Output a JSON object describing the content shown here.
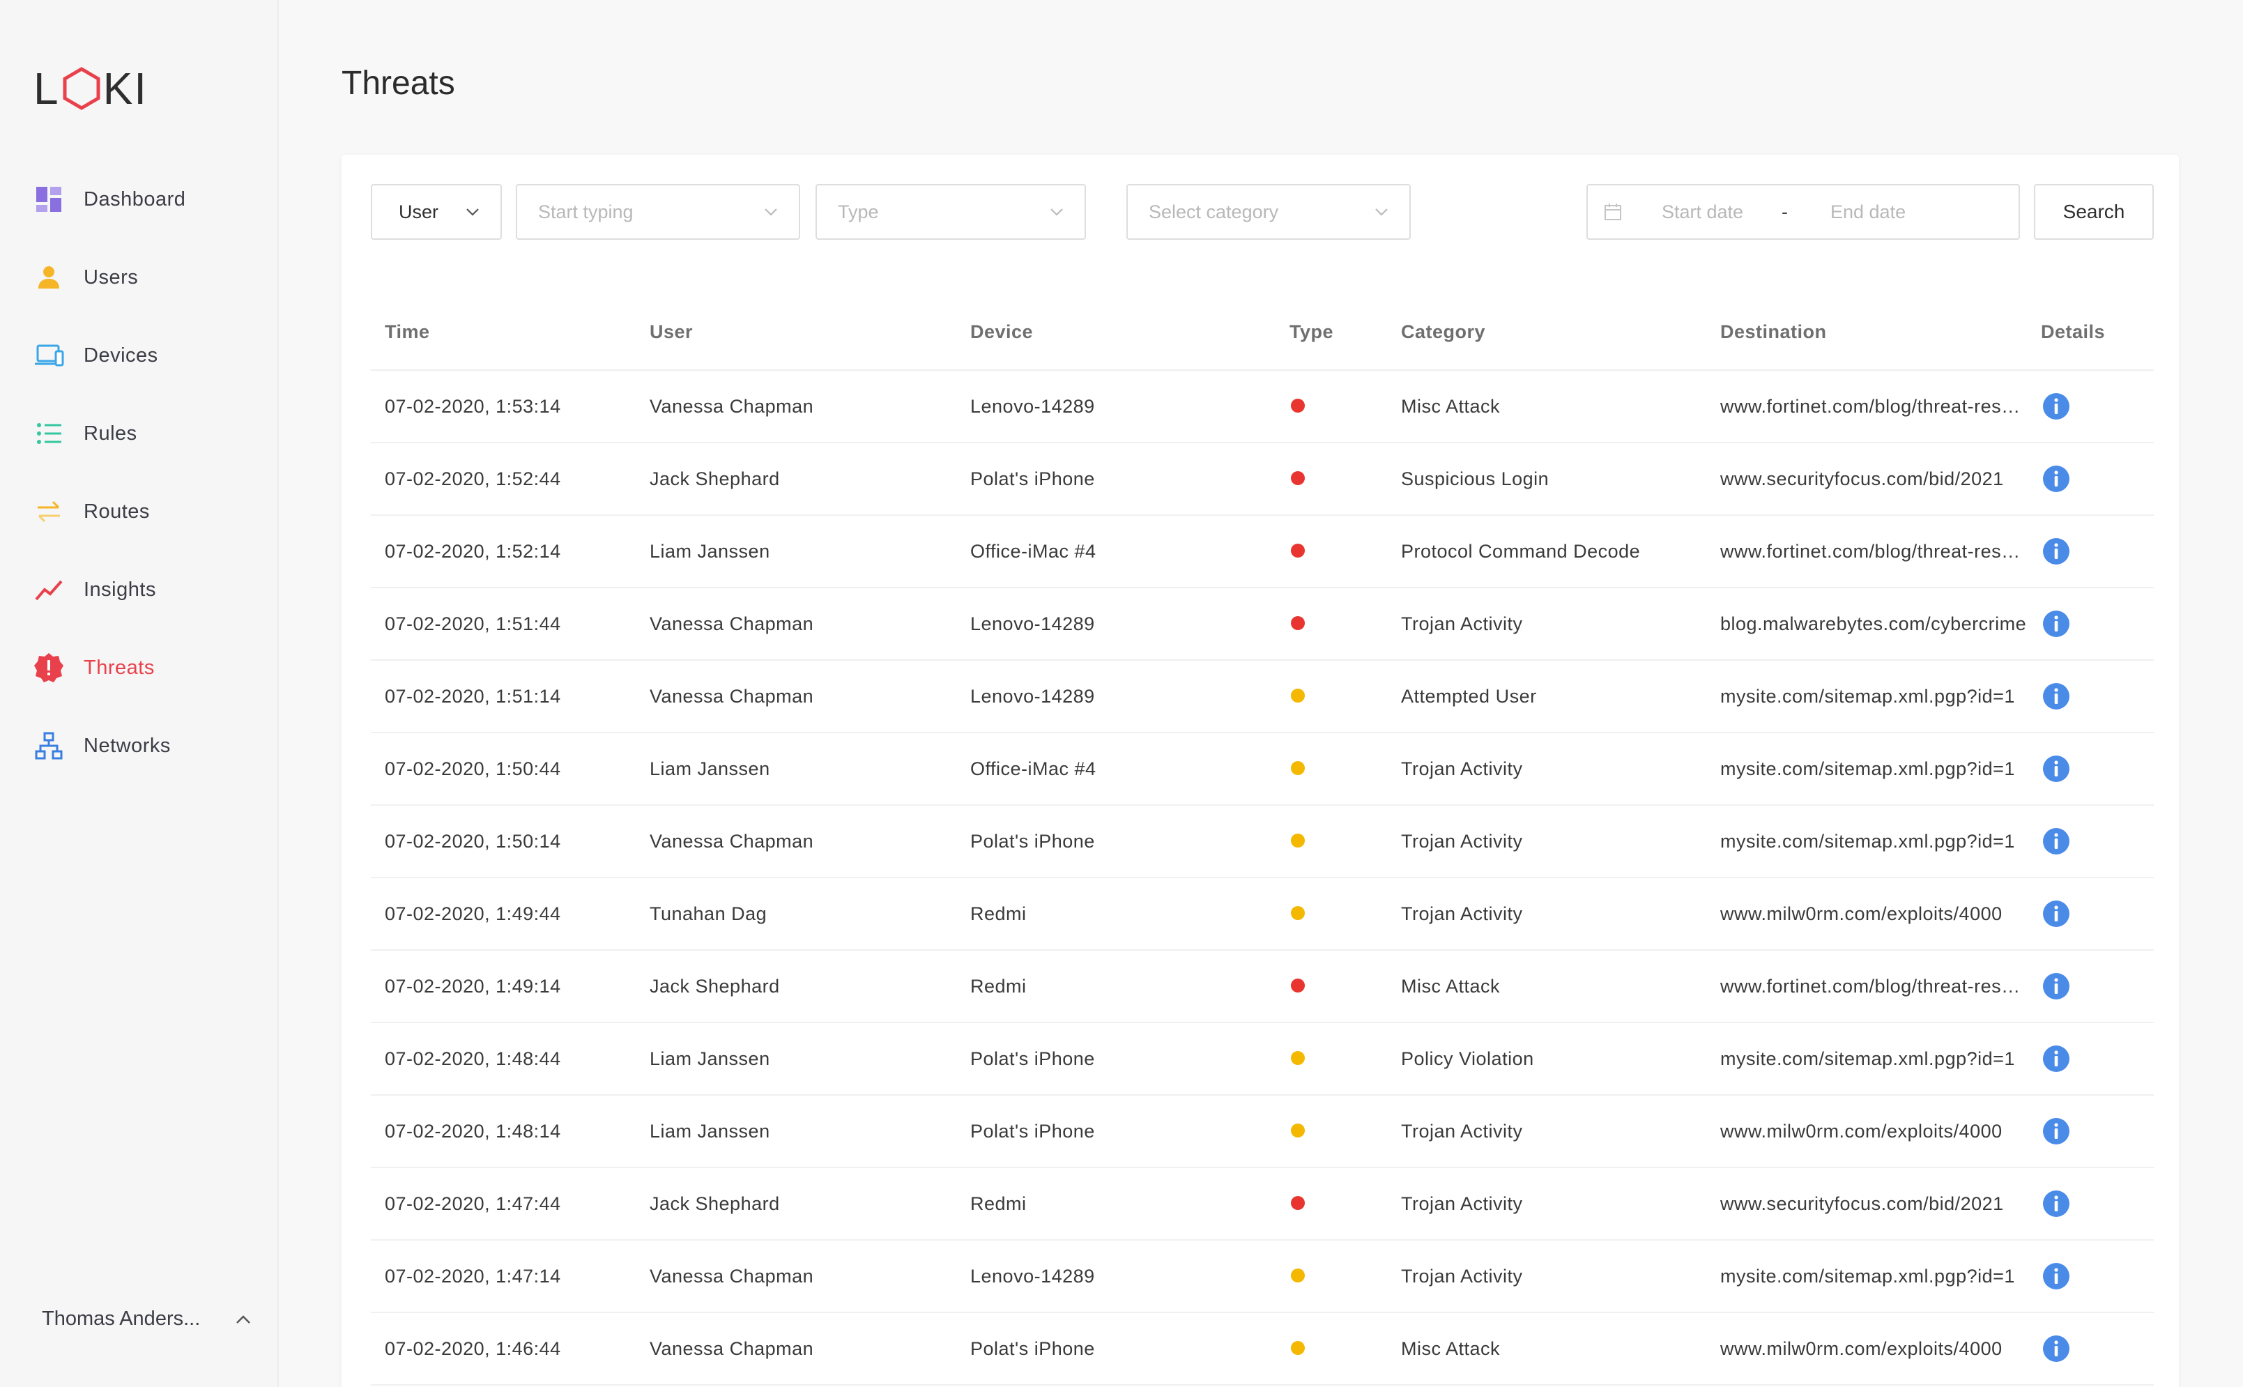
{
  "app": {
    "logo": "LOKI"
  },
  "sidebar": {
    "items": [
      {
        "label": "Dashboard",
        "icon": "dashboard-icon",
        "color": "#8a6fe0",
        "active": false
      },
      {
        "label": "Users",
        "icon": "user-icon",
        "color": "#f5b526",
        "active": false
      },
      {
        "label": "Devices",
        "icon": "devices-icon",
        "color": "#3aa6e8",
        "active": false
      },
      {
        "label": "Rules",
        "icon": "list-icon",
        "color": "#34c7a0",
        "active": false
      },
      {
        "label": "Routes",
        "icon": "swap-arrows-icon",
        "color": "#f5b526",
        "active": false
      },
      {
        "label": "Insights",
        "icon": "trend-line-icon",
        "color": "#e8414b",
        "active": false
      },
      {
        "label": "Threats",
        "icon": "alert-badge-icon",
        "color": "#e8414b",
        "active": true
      },
      {
        "label": "Networks",
        "icon": "network-icon",
        "color": "#3a7fe0",
        "active": false
      }
    ],
    "user_name": "Thomas Anders..."
  },
  "page": {
    "title": "Threats"
  },
  "filters": {
    "user_select": "User",
    "typing_placeholder": "Start typing",
    "type_placeholder": "Type",
    "category_placeholder": "Select category",
    "start_date_placeholder": "Start date",
    "date_separator": "-",
    "end_date_placeholder": "End date",
    "search_label": "Search"
  },
  "table": {
    "columns": [
      "Time",
      "User",
      "Device",
      "Type",
      "Category",
      "Destination",
      "Details"
    ],
    "type_colors": {
      "high": "#e8352f",
      "medium": "#f5b800"
    },
    "rows": [
      {
        "time": "07-02-2020, 1:53:14",
        "user": "Vanessa Chapman",
        "device": "Lenovo-14289",
        "type": "high",
        "category": "Misc Attack",
        "destination": "www.fortinet.com/blog/threat-research"
      },
      {
        "time": "07-02-2020, 1:52:44",
        "user": "Jack Shephard",
        "device": "Polat's iPhone",
        "type": "high",
        "category": "Suspicious Login",
        "destination": "www.securityfocus.com/bid/2021"
      },
      {
        "time": "07-02-2020, 1:52:14",
        "user": "Liam Janssen",
        "device": "Office-iMac #4",
        "type": "high",
        "category": "Protocol Command Decode",
        "destination": "www.fortinet.com/blog/threat-research"
      },
      {
        "time": "07-02-2020, 1:51:44",
        "user": "Vanessa Chapman",
        "device": "Lenovo-14289",
        "type": "high",
        "category": "Trojan Activity",
        "destination": "blog.malwarebytes.com/cybercrime"
      },
      {
        "time": "07-02-2020, 1:51:14",
        "user": "Vanessa Chapman",
        "device": "Lenovo-14289",
        "type": "medium",
        "category": "Attempted User",
        "destination": "mysite.com/sitemap.xml.pgp?id=1"
      },
      {
        "time": "07-02-2020, 1:50:44",
        "user": "Liam Janssen",
        "device": "Office-iMac #4",
        "type": "medium",
        "category": "Trojan Activity",
        "destination": "mysite.com/sitemap.xml.pgp?id=1"
      },
      {
        "time": "07-02-2020, 1:50:14",
        "user": "Vanessa Chapman",
        "device": "Polat's iPhone",
        "type": "medium",
        "category": "Trojan Activity",
        "destination": "mysite.com/sitemap.xml.pgp?id=1"
      },
      {
        "time": "07-02-2020, 1:49:44",
        "user": "Tunahan Dag",
        "device": "Redmi",
        "type": "medium",
        "category": "Trojan Activity",
        "destination": "www.milw0rm.com/exploits/4000"
      },
      {
        "time": "07-02-2020, 1:49:14",
        "user": "Jack Shephard",
        "device": "Redmi",
        "type": "high",
        "category": "Misc Attack",
        "destination": "www.fortinet.com/blog/threat-research"
      },
      {
        "time": "07-02-2020, 1:48:44",
        "user": "Liam Janssen",
        "device": "Polat's iPhone",
        "type": "medium",
        "category": "Policy Violation",
        "destination": "mysite.com/sitemap.xml.pgp?id=1"
      },
      {
        "time": "07-02-2020, 1:48:14",
        "user": "Liam Janssen",
        "device": "Polat's iPhone",
        "type": "medium",
        "category": "Trojan Activity",
        "destination": "www.milw0rm.com/exploits/4000"
      },
      {
        "time": "07-02-2020, 1:47:44",
        "user": "Jack Shephard",
        "device": "Redmi",
        "type": "high",
        "category": "Trojan Activity",
        "destination": "www.securityfocus.com/bid/2021"
      },
      {
        "time": "07-02-2020, 1:47:14",
        "user": "Vanessa Chapman",
        "device": "Lenovo-14289",
        "type": "medium",
        "category": "Trojan Activity",
        "destination": "mysite.com/sitemap.xml.pgp?id=1"
      },
      {
        "time": "07-02-2020, 1:46:44",
        "user": "Vanessa Chapman",
        "device": "Polat's iPhone",
        "type": "medium",
        "category": "Misc Attack",
        "destination": "www.milw0rm.com/exploits/4000"
      }
    ]
  }
}
